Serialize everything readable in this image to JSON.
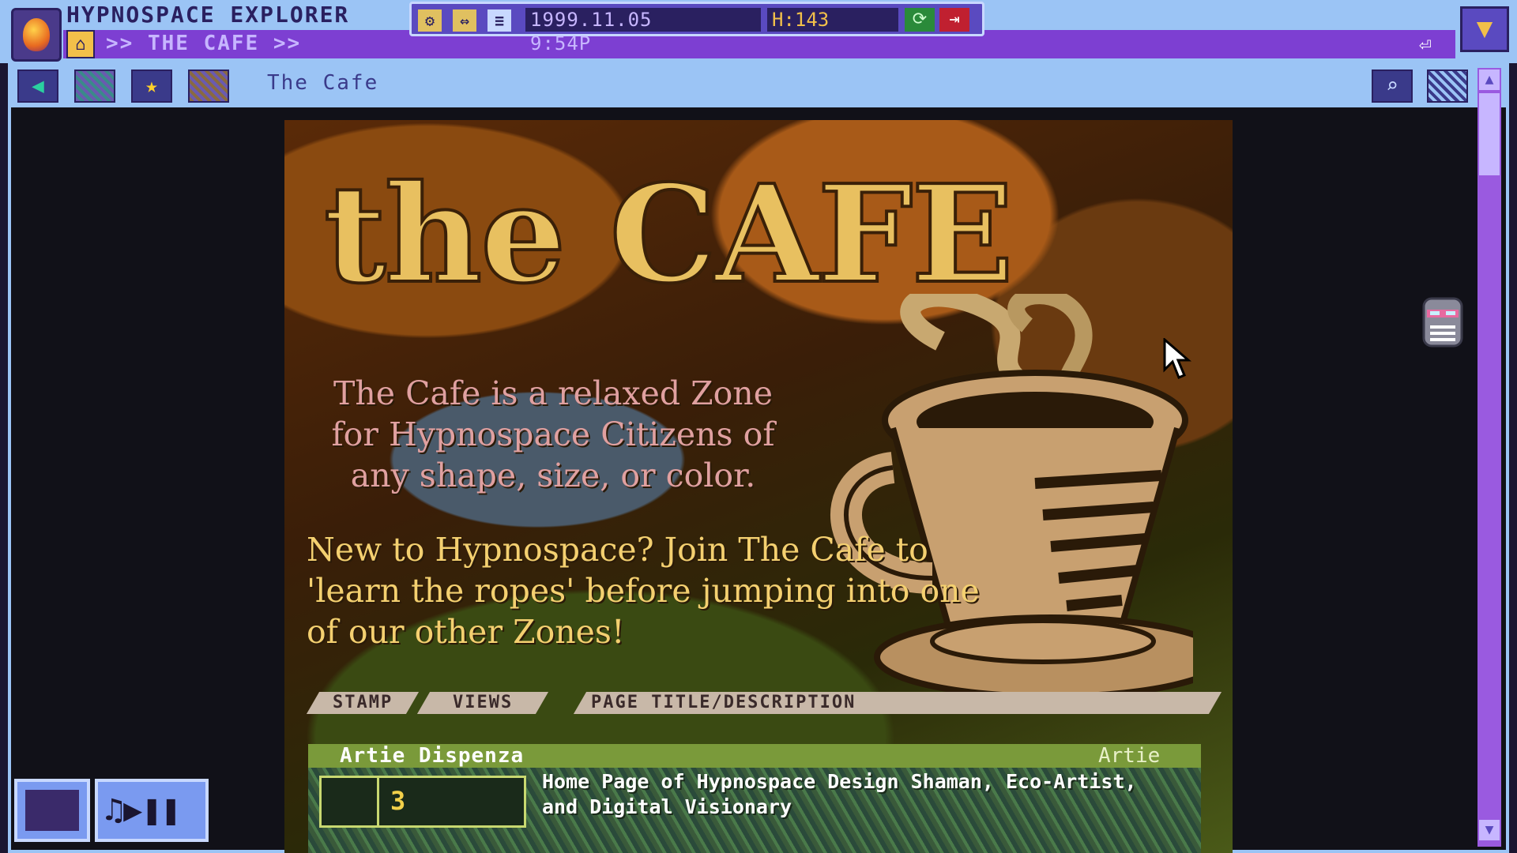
{
  "app": {
    "title": "HYPNOSPACE EXPLORER",
    "address": ">> THE CAFE >>",
    "date": "1999.11.05",
    "time": "9:54P",
    "counter": "H:143"
  },
  "nav": {
    "page_title": "The Cafe"
  },
  "page": {
    "heading": "the CAFE",
    "description": "The Cafe is a relaxed Zone for Hypnospace Citizens of any shape, size, or color.",
    "invite": "New to Hypnospace? Join The Cafe to 'learn the ropes' before jumping into one of our other Zones!",
    "columns": [
      "STAMP",
      "VIEWS",
      "PAGE TITLE/DESCRIPTION"
    ],
    "rows": [
      {
        "name": "Artie Dispenza",
        "user": "Artie",
        "views": "3",
        "description": "Home Page of Hypnospace Design Shaman, Eco-Artist, and Digital Visionary"
      }
    ]
  },
  "colors": {
    "chrome": "#9bc4f5",
    "accent": "#7d3fd2",
    "title_gold": "#e8c060"
  },
  "icons": [
    "home-icon",
    "settings-icon",
    "expand-icon",
    "menu-icon",
    "refresh-icon",
    "logout-icon",
    "back-icon",
    "star-icon",
    "search-icon",
    "minimize-icon",
    "play-pause-icon"
  ]
}
